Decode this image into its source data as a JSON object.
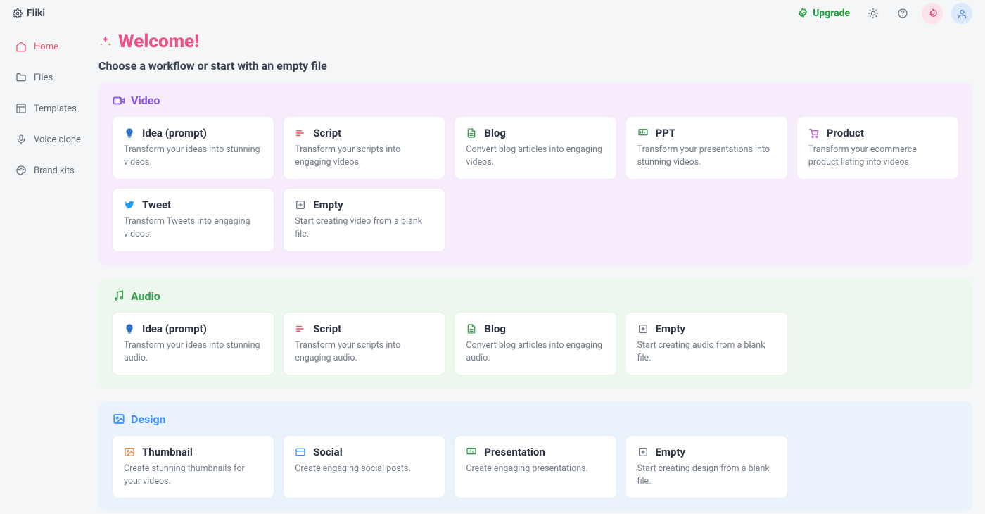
{
  "header": {
    "brand": "Fliki",
    "upgrade": "Upgrade"
  },
  "sidebar": {
    "items": [
      {
        "label": "Home"
      },
      {
        "label": "Files"
      },
      {
        "label": "Templates"
      },
      {
        "label": "Voice clone"
      },
      {
        "label": "Brand kits"
      }
    ]
  },
  "welcome": {
    "title": "Welcome!",
    "subtitle": "Choose a workflow or start with an empty file"
  },
  "sections": {
    "video": {
      "title": "Video",
      "cards": [
        {
          "title": "Idea (prompt)",
          "desc": "Transform your ideas into stunning videos."
        },
        {
          "title": "Script",
          "desc": "Transform your scripts into engaging videos."
        },
        {
          "title": "Blog",
          "desc": "Convert blog articles into engaging videos."
        },
        {
          "title": "PPT",
          "desc": "Transform your presentations into stunning videos."
        },
        {
          "title": "Product",
          "desc": "Transform your ecommerce product listing into videos."
        },
        {
          "title": "Tweet",
          "desc": "Transform Tweets into engaging videos."
        },
        {
          "title": "Empty",
          "desc": "Start creating video from a blank file."
        }
      ]
    },
    "audio": {
      "title": "Audio",
      "cards": [
        {
          "title": "Idea (prompt)",
          "desc": "Transform your ideas into stunning audio."
        },
        {
          "title": "Script",
          "desc": "Transform your scripts into engaging audio."
        },
        {
          "title": "Blog",
          "desc": "Convert blog articles into engaging audio."
        },
        {
          "title": "Empty",
          "desc": "Start creating audio from a blank file."
        }
      ]
    },
    "design": {
      "title": "Design",
      "cards": [
        {
          "title": "Thumbnail",
          "desc": "Create stunning thumbnails for your videos."
        },
        {
          "title": "Social",
          "desc": "Create engaging social posts."
        },
        {
          "title": "Presentation",
          "desc": "Create engaging presentations."
        },
        {
          "title": "Empty",
          "desc": "Start creating design from a blank file."
        }
      ]
    }
  }
}
